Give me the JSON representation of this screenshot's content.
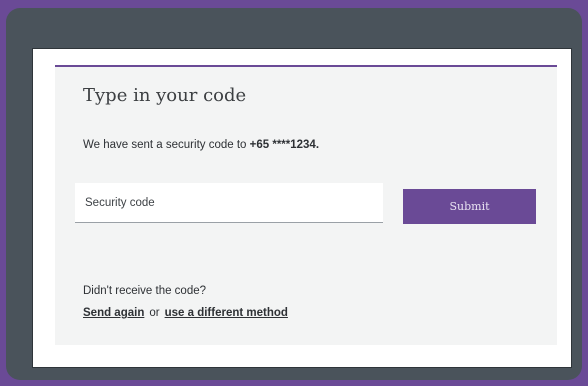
{
  "verification": {
    "title": "Type in your code",
    "message_prefix": "We have sent a security code to ",
    "phone_number": "+65 ****1234.",
    "input": {
      "placeholder": "Security code",
      "value": ""
    },
    "submit_label": "Submit",
    "no_code_text": "Didn't receive the code?",
    "send_again_label": "Send again",
    "or_text": "or",
    "different_method_label": "use a different method"
  },
  "colors": {
    "accent": "#6a4a96",
    "bezel": "#4a535b",
    "card_background": "#f3f4f4"
  }
}
